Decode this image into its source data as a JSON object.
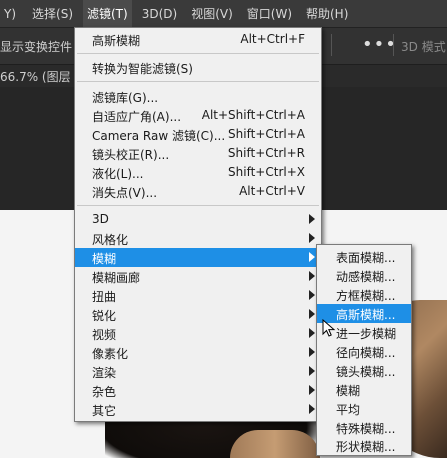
{
  "menubar": {
    "items": [
      {
        "label": "Y)"
      },
      {
        "label": "选择(S)"
      },
      {
        "label": "滤镜(T)"
      },
      {
        "label": "3D(D)"
      },
      {
        "label": "视图(V)"
      },
      {
        "label": "窗口(W)"
      },
      {
        "label": "帮助(H)"
      }
    ]
  },
  "options": {
    "show_transform_controls": "显示变换控件",
    "more": "•••",
    "mode_3d": "3D 模式"
  },
  "document": {
    "tab_text": "66.7% (图层"
  },
  "filter_menu": {
    "group1": [
      {
        "label": "高斯模糊",
        "shortcut": "Alt+Ctrl+F"
      }
    ],
    "group2": [
      {
        "label": "转换为智能滤镜(S)"
      }
    ],
    "group3": [
      {
        "label": "滤镜库(G)...",
        "shortcut": ""
      },
      {
        "label": "自适应广角(A)...",
        "shortcut": "Alt+Shift+Ctrl+A"
      },
      {
        "label": "Camera Raw 滤镜(C)...",
        "shortcut": "Shift+Ctrl+A"
      },
      {
        "label": "镜头校正(R)...",
        "shortcut": "Shift+Ctrl+R"
      },
      {
        "label": "液化(L)...",
        "shortcut": "Shift+Ctrl+X"
      },
      {
        "label": "消失点(V)...",
        "shortcut": "Alt+Ctrl+V"
      }
    ],
    "group4": [
      {
        "label": "3D"
      },
      {
        "label": "风格化"
      },
      {
        "label": "模糊"
      },
      {
        "label": "模糊画廊"
      },
      {
        "label": "扭曲"
      },
      {
        "label": "锐化"
      },
      {
        "label": "视频"
      },
      {
        "label": "像素化"
      },
      {
        "label": "渲染"
      },
      {
        "label": "杂色"
      },
      {
        "label": "其它"
      }
    ]
  },
  "blur_submenu": {
    "items": [
      {
        "label": "表面模糊..."
      },
      {
        "label": "动感模糊..."
      },
      {
        "label": "方框模糊..."
      },
      {
        "label": "高斯模糊..."
      },
      {
        "label": "进一步模糊"
      },
      {
        "label": "径向模糊..."
      },
      {
        "label": "镜头模糊..."
      },
      {
        "label": "模糊"
      },
      {
        "label": "平均"
      },
      {
        "label": "特殊模糊..."
      },
      {
        "label": "形状模糊..."
      }
    ]
  },
  "colors": {
    "highlight": "#1e8fe6",
    "menu_bg": "#f0f0f0",
    "chrome_dark": "#323232"
  }
}
